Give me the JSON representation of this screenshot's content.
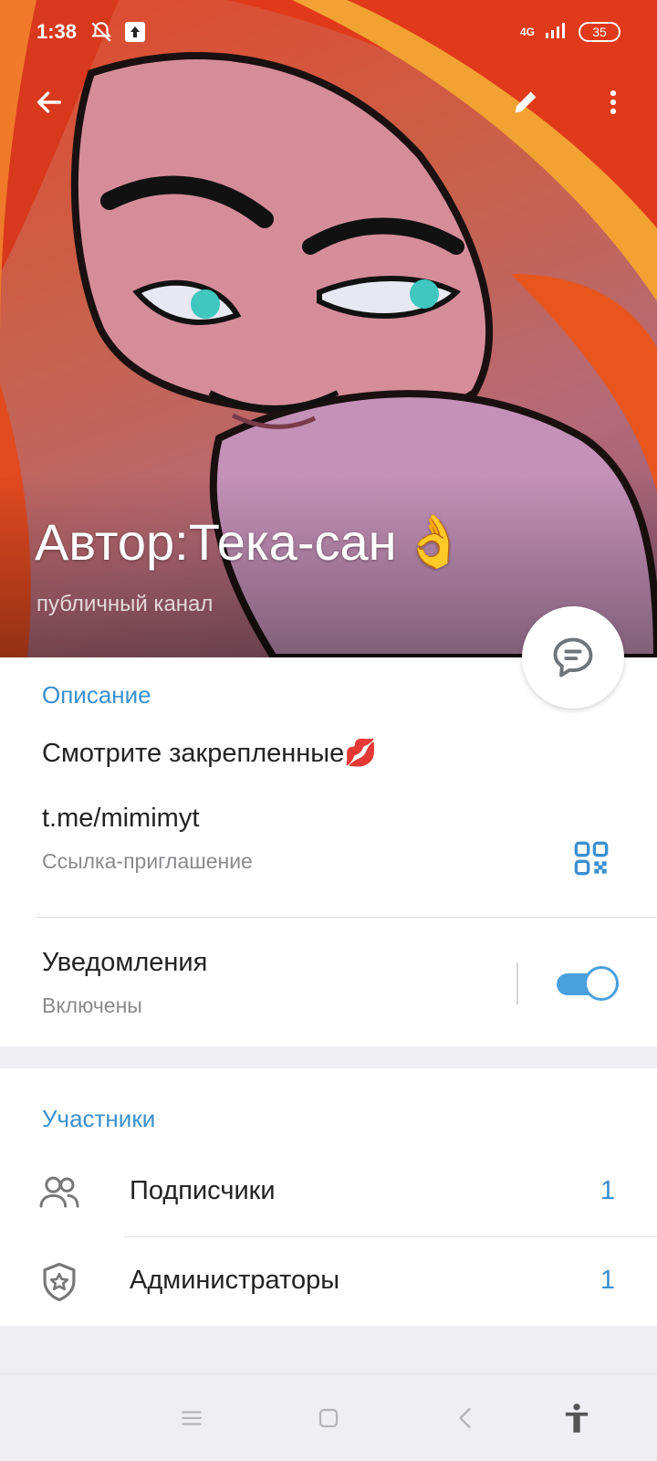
{
  "status_bar": {
    "time": "1:38",
    "network": "4G",
    "battery": "35",
    "icons": [
      "bell-off-icon",
      "upload-icon",
      "signal-icon",
      "battery-icon"
    ]
  },
  "toolbar": {
    "icons": [
      "back-arrow-icon",
      "pencil-icon",
      "more-vertical-icon"
    ]
  },
  "channel": {
    "name": "Автор:Тека-сан",
    "name_emoji": "👌",
    "type": "публичный канал"
  },
  "info": {
    "description_header": "Описание",
    "description": "Смотрите закрепленные",
    "description_emoji": "💋",
    "link": "t.me/mimimyt",
    "link_label": "Ссылка-приглашение",
    "notifications_label": "Уведомления",
    "notifications_status": "Включены",
    "notifications_on": true
  },
  "members": {
    "header": "Участники",
    "rows": [
      {
        "label": "Подписчики",
        "count": "1",
        "icon": "people-icon"
      },
      {
        "label": "Администраторы",
        "count": "1",
        "icon": "shield-star-icon"
      }
    ]
  },
  "colors": {
    "accent": "#3a8fd0",
    "toggle": "#4a9fdd",
    "background": "#efeff3"
  },
  "nav_bar": {
    "icons": [
      "menu-icon",
      "home-square-icon",
      "back-chevron-icon",
      "accessibility-icon"
    ]
  }
}
